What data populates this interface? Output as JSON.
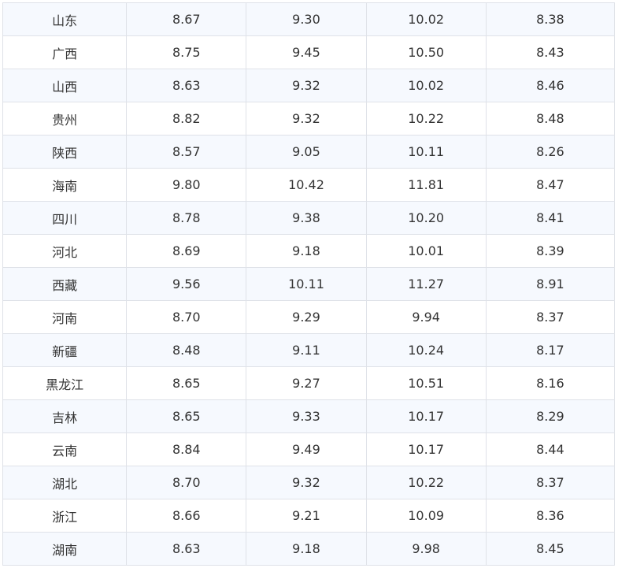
{
  "table": {
    "rows": [
      [
        "山东",
        "8.67",
        "9.30",
        "10.02",
        "8.38"
      ],
      [
        "广西",
        "8.75",
        "9.45",
        "10.50",
        "8.43"
      ],
      [
        "山西",
        "8.63",
        "9.32",
        "10.02",
        "8.46"
      ],
      [
        "贵州",
        "8.82",
        "9.32",
        "10.22",
        "8.48"
      ],
      [
        "陕西",
        "8.57",
        "9.05",
        "10.11",
        "8.26"
      ],
      [
        "海南",
        "9.80",
        "10.42",
        "11.81",
        "8.47"
      ],
      [
        "四川",
        "8.78",
        "9.38",
        "10.20",
        "8.41"
      ],
      [
        "河北",
        "8.69",
        "9.18",
        "10.01",
        "8.39"
      ],
      [
        "西藏",
        "9.56",
        "10.11",
        "11.27",
        "8.91"
      ],
      [
        "河南",
        "8.70",
        "9.29",
        "9.94",
        "8.37"
      ],
      [
        "新疆",
        "8.48",
        "9.11",
        "10.24",
        "8.17"
      ],
      [
        "黑龙江",
        "8.65",
        "9.27",
        "10.51",
        "8.16"
      ],
      [
        "吉林",
        "8.65",
        "9.33",
        "10.17",
        "8.29"
      ],
      [
        "云南",
        "8.84",
        "9.49",
        "10.17",
        "8.44"
      ],
      [
        "湖北",
        "8.70",
        "9.32",
        "10.22",
        "8.37"
      ],
      [
        "浙江",
        "8.66",
        "9.21",
        "10.09",
        "8.36"
      ],
      [
        "湖南",
        "8.63",
        "9.18",
        "9.98",
        "8.45"
      ]
    ]
  }
}
